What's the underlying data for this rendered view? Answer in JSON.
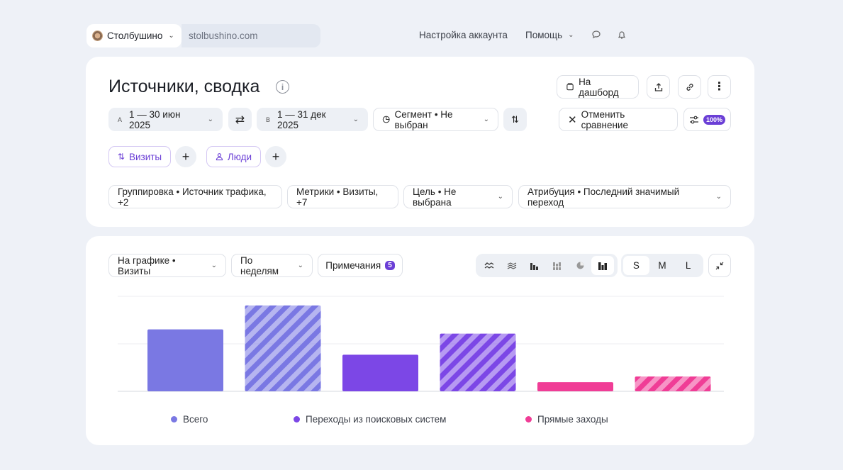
{
  "topbar": {
    "site_name": "Столбушино",
    "site_url": "stolbushino.com",
    "account_settings": "Настройка аккаунта",
    "help": "Помощь"
  },
  "report": {
    "title": "Источники, сводка",
    "dashboard_button": "На дашборд",
    "date_a_letter": "A",
    "date_a": "1 — 30 июн 2025",
    "date_b_letter": "B",
    "date_b": "1 — 31 дек 2025",
    "segment": "Сегмент • Не выбран",
    "cancel_compare": "Отменить сравнение",
    "sampling": "100%",
    "visits_tag": "Визиты",
    "people_tag": "Люди",
    "grouping": "Группировка • Источник трафика, +2",
    "metrics": "Метрики • Визиты, +7",
    "goal": "Цель • Не выбрана",
    "attribution": "Атрибуция • Последний значимый переход"
  },
  "chart_panel": {
    "on_chart": "На графике • Визиты",
    "by_weeks": "По неделям",
    "notes": "Примечания",
    "notes_count": "5",
    "sizes": [
      "S",
      "M",
      "L"
    ],
    "active_size": "S",
    "icons": [
      "area-chart-icon",
      "stacked-area-icon",
      "column-chart-icon",
      "stacked-column-icon",
      "pie-chart-icon",
      "bar-chart-icon"
    ]
  },
  "chart_data": {
    "type": "bar",
    "categories": [
      "Всего A",
      "Всего B",
      "Переходы из поисковых систем A",
      "Переходы из поисковых систем B",
      "Прямые заходы A",
      "Прямые заходы B"
    ],
    "values": [
      88,
      122,
      52,
      82,
      13,
      21
    ],
    "ylim": [
      0,
      135
    ],
    "grid": true,
    "legend_position": "bottom",
    "series": [
      {
        "name": "Всего",
        "color": "#7a78e3"
      },
      {
        "name": "Переходы из поисковых систем",
        "color": "#7c47e6"
      },
      {
        "name": "Прямые заходы",
        "color": "#f03d96"
      }
    ]
  }
}
